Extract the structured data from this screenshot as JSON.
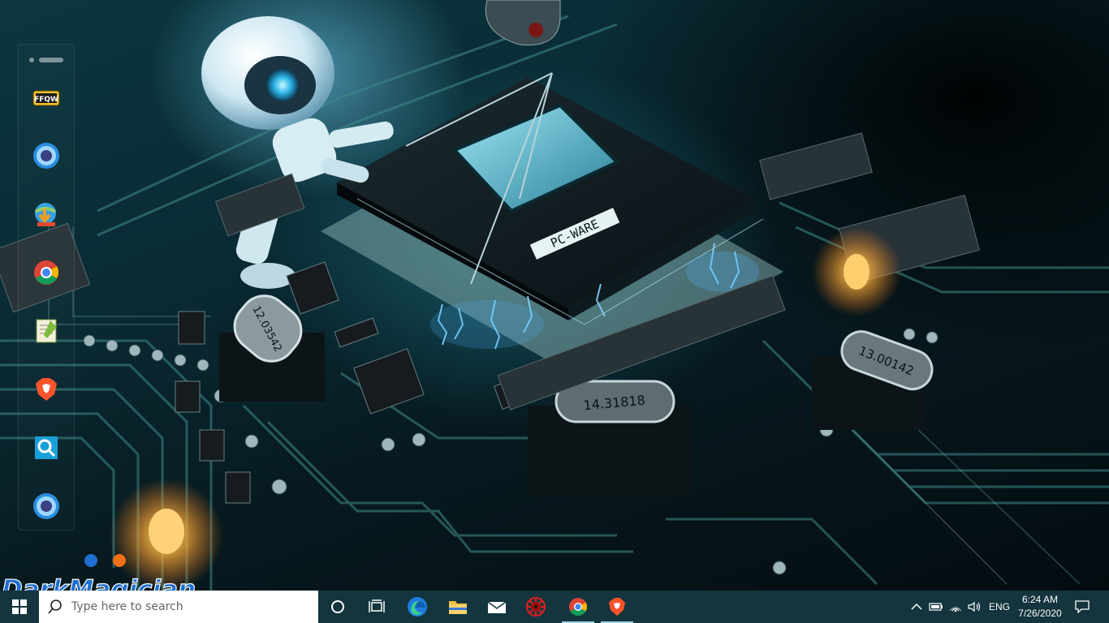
{
  "desktop": {
    "wallpaper": {
      "chip_label": "PC-WARE",
      "crystal_1": "14.31818",
      "crystal_2": "13.00142",
      "crystal_3": "12.03542"
    },
    "dock": {
      "items": [
        {
          "name": "ffqw-app",
          "icon": "ffqw-icon",
          "label": "FFQW"
        },
        {
          "name": "media-player-app",
          "icon": "blue-orb-icon"
        },
        {
          "name": "download-manager-app",
          "icon": "globe-download-icon"
        },
        {
          "name": "chrome-app",
          "icon": "chrome-icon"
        },
        {
          "name": "notepad-plus-plus-app",
          "icon": "notepad-plus-plus-icon"
        },
        {
          "name": "brave-app",
          "icon": "brave-icon"
        },
        {
          "name": "search-utility-app",
          "icon": "magnifier-icon"
        },
        {
          "name": "media-player-2-app",
          "icon": "blue-orb-icon"
        }
      ]
    },
    "watermark": {
      "text": "DarkMagician"
    }
  },
  "taskbar": {
    "search_placeholder": "Type here to search",
    "pinned": [
      {
        "name": "cortana-button",
        "icon": "cortana-circle-icon"
      },
      {
        "name": "task-view-button",
        "icon": "task-view-icon"
      },
      {
        "name": "edge-button",
        "icon": "edge-icon"
      },
      {
        "name": "file-explorer-button",
        "icon": "folder-icon"
      },
      {
        "name": "mail-button",
        "icon": "mail-icon"
      },
      {
        "name": "red-app-button",
        "icon": "red-gear-icon"
      },
      {
        "name": "chrome-taskbar-button",
        "icon": "chrome-icon",
        "running": true
      },
      {
        "name": "brave-taskbar-button",
        "icon": "brave-icon",
        "running": true
      }
    ],
    "tray": {
      "language": "ENG",
      "time": "6:24 AM",
      "date": "7/26/2020"
    }
  },
  "colors": {
    "taskbar": "#14353d",
    "accent": "#9ad0e0",
    "watermark_blue": "#1e6fd0",
    "watermark_orange": "#f07018"
  }
}
